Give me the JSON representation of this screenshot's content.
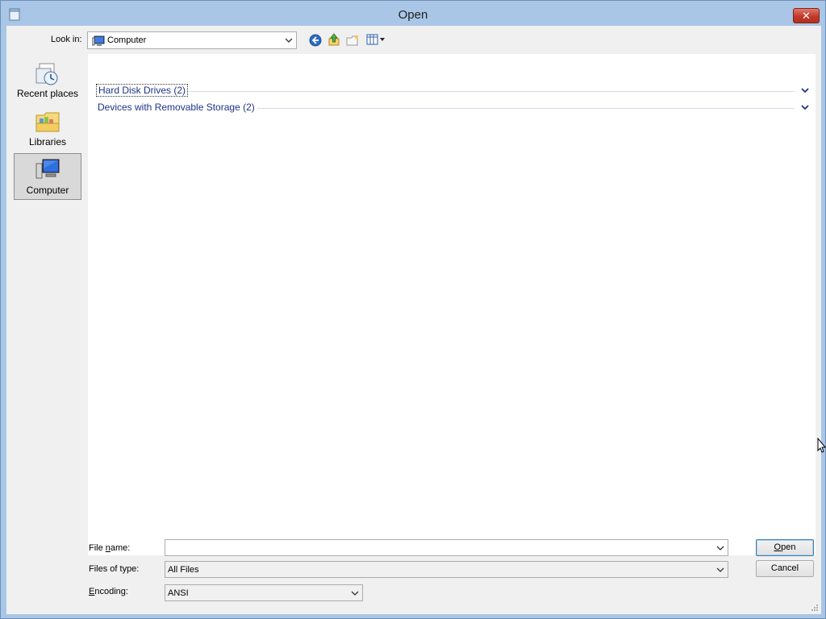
{
  "window": {
    "title": "Open",
    "close_glyph": "✕"
  },
  "toolbar": {
    "look_in_label": "Look in:",
    "look_in_value": "Computer",
    "icons": [
      "back-icon",
      "up-folder-icon",
      "new-folder-icon",
      "views-menu-icon"
    ]
  },
  "places": [
    {
      "label": "Recent places",
      "icon": "recent-places-icon",
      "selected": false
    },
    {
      "label": "Libraries",
      "icon": "libraries-icon",
      "selected": false
    },
    {
      "label": "Computer",
      "icon": "computer-icon",
      "selected": true
    }
  ],
  "groups": [
    {
      "label": "Hard Disk Drives (2)",
      "focused": true
    },
    {
      "label": "Devices with Removable Storage (2)",
      "focused": false
    }
  ],
  "form": {
    "file_name_label_pre": "File ",
    "file_name_label_u": "n",
    "file_name_label_post": "ame:",
    "file_name_value": "",
    "files_of_type_label": "Files of type:",
    "files_of_type_value": "All Files",
    "encoding_label_pre": "",
    "encoding_label_u": "E",
    "encoding_label_post": "ncoding:",
    "encoding_value": "ANSI"
  },
  "buttons": {
    "open_pre": "",
    "open_u": "O",
    "open_post": "pen",
    "cancel": "Cancel"
  },
  "colors": {
    "title_bar": "#a9c6e7",
    "group_header_text": "#1e3287",
    "close_button": "#c23a2a"
  }
}
